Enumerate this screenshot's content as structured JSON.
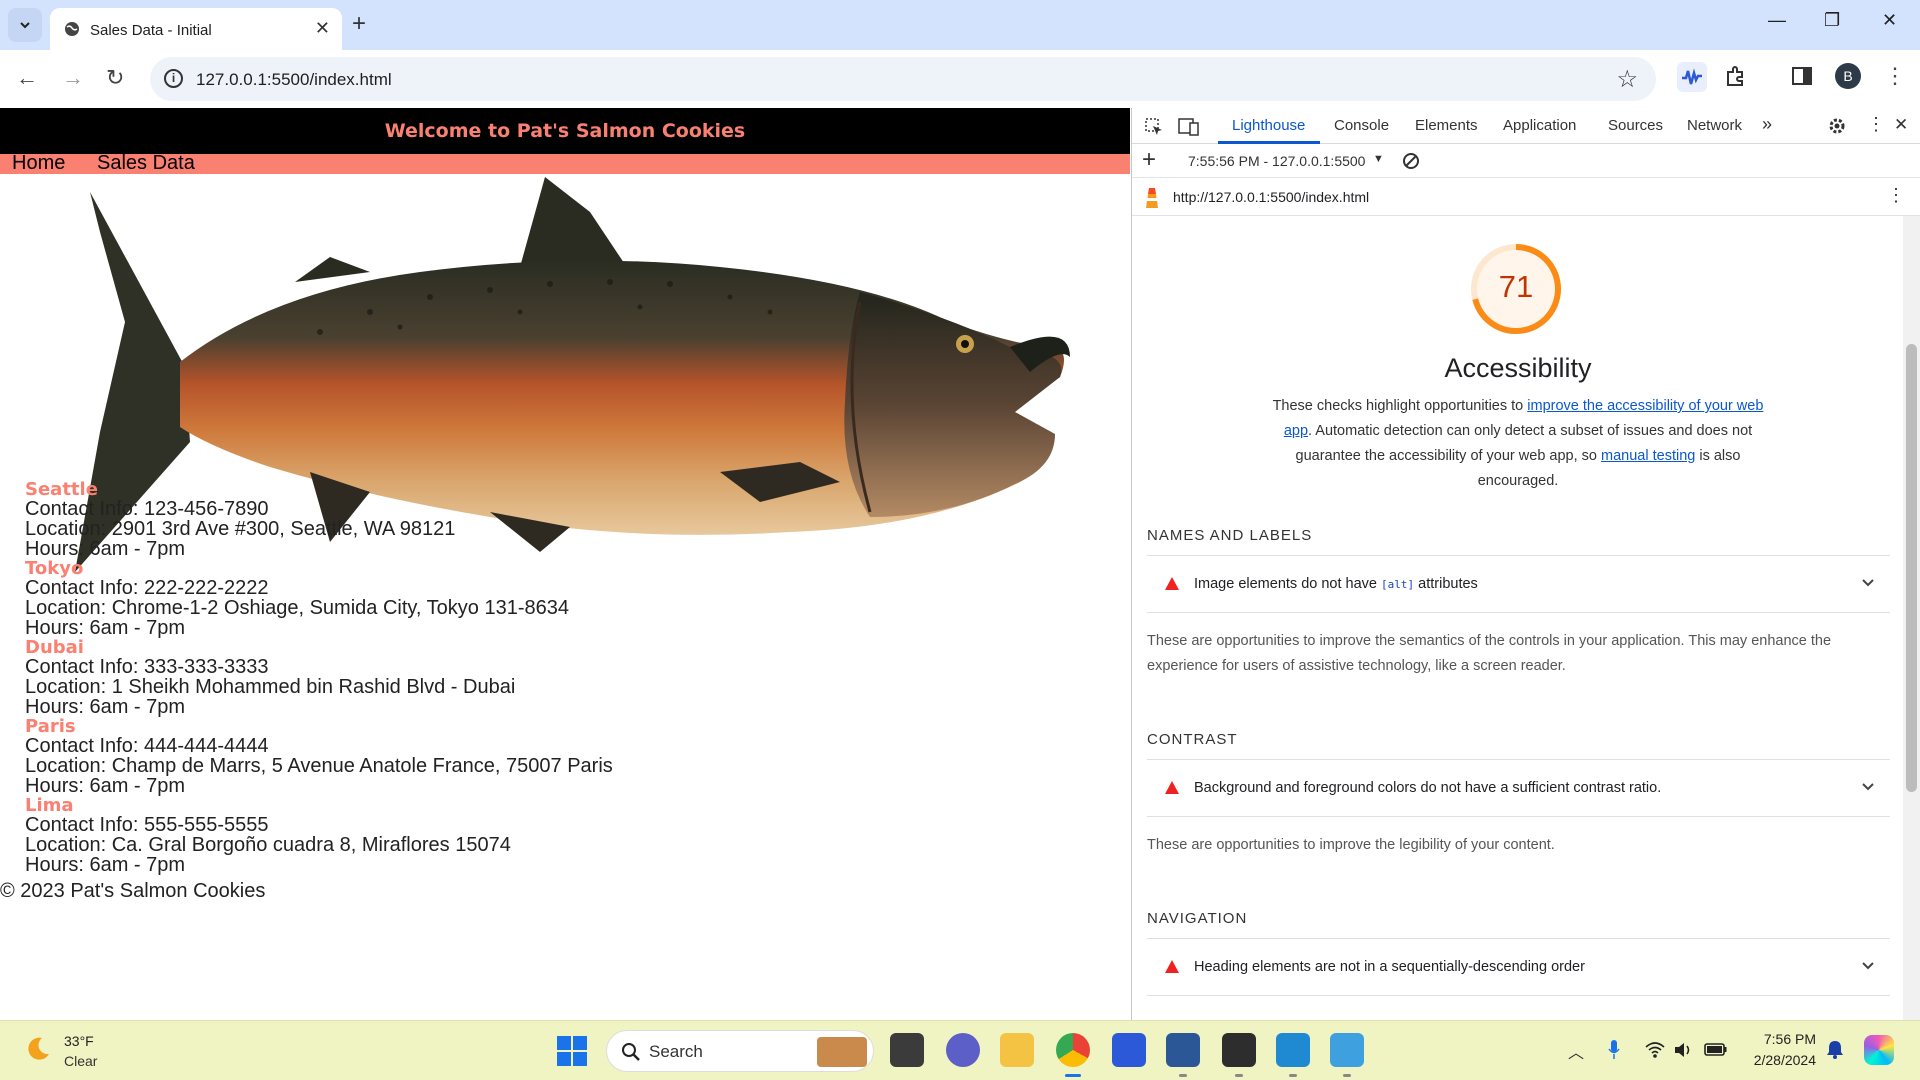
{
  "browser": {
    "tab_title": "Sales Data - Initial",
    "url": "127.0.0.1:5500/index.html"
  },
  "site": {
    "header_title": "Welcome to Pat's Salmon Cookies",
    "nav": [
      "Home",
      "Sales Data"
    ],
    "locations": [
      {
        "name": "Seattle",
        "contact": "Contact Info: 123-456-7890",
        "location": "Location: 2901 3rd Ave #300, Seattle, WA 98121",
        "hours": "Hours: 6am - 7pm"
      },
      {
        "name": "Tokyo",
        "contact": "Contact Info: 222-222-2222",
        "location": "Location: Chrome-1-2 Oshiage, Sumida City, Tokyo 131-8634",
        "hours": "Hours: 6am - 7pm"
      },
      {
        "name": "Dubai",
        "contact": "Contact Info: 333-333-3333",
        "location": "Location: 1 Sheikh Mohammed bin Rashid Blvd - Dubai",
        "hours": "Hours: 6am - 7pm"
      },
      {
        "name": "Paris",
        "contact": "Contact Info: 444-444-4444",
        "location": "Location: Champ de Marrs, 5 Avenue Anatole France, 75007 Paris",
        "hours": "Hours: 6am - 7pm"
      },
      {
        "name": "Lima",
        "contact": "Contact Info: 555-555-5555",
        "location": "Location: Ca. Gral Borgoño cuadra 8, Miraflores 15074",
        "hours": "Hours: 6am - 7pm"
      }
    ],
    "footer": "© 2023 Pat's Salmon Cookies"
  },
  "devtools": {
    "tabs": [
      "Lighthouse",
      "Console",
      "Elements",
      "Application",
      "Sources",
      "Network"
    ],
    "active_tab": "Lighthouse",
    "report_selector": "7:55:56 PM - 127.0.0.1:5500",
    "report_url": "http://127.0.0.1:5500/index.html",
    "score": 71,
    "score_color": "#fa8b16",
    "category_title": "Accessibility",
    "description": {
      "part1": "These checks highlight opportunities to ",
      "link1": "improve the accessibility of your web app",
      "part2": ". Automatic detection can only detect a subset of issues and does not guarantee the accessibility of your web app, so ",
      "link2": "manual testing",
      "part3": " is also encouraged."
    },
    "groups": [
      {
        "title": "NAMES AND LABELS",
        "audit_pre": "Image elements do not have ",
        "audit_code": "[alt]",
        "audit_post": " attributes",
        "desc": "These are opportunities to improve the semantics of the controls in your application. This may enhance the experience for users of assistive technology, like a screen reader."
      },
      {
        "title": "CONTRAST",
        "audit_pre": "Background and foreground colors do not have a sufficient contrast ratio.",
        "audit_code": "",
        "audit_post": "",
        "desc": "These are opportunities to improve the legibility of your content."
      },
      {
        "title": "NAVIGATION",
        "audit_pre": "Heading elements are not in a sequentially-descending order",
        "audit_code": "",
        "audit_post": "",
        "desc": ""
      }
    ]
  },
  "taskbar": {
    "weather_temp": "33°F",
    "weather_condition": "Clear",
    "search_placeholder": "Search",
    "time": "7:56 PM",
    "date": "2/28/2024"
  },
  "colors": {
    "salmon": "#fa8072",
    "devtools_accent": "#0b57d0",
    "fail_red": "#ee2222"
  }
}
